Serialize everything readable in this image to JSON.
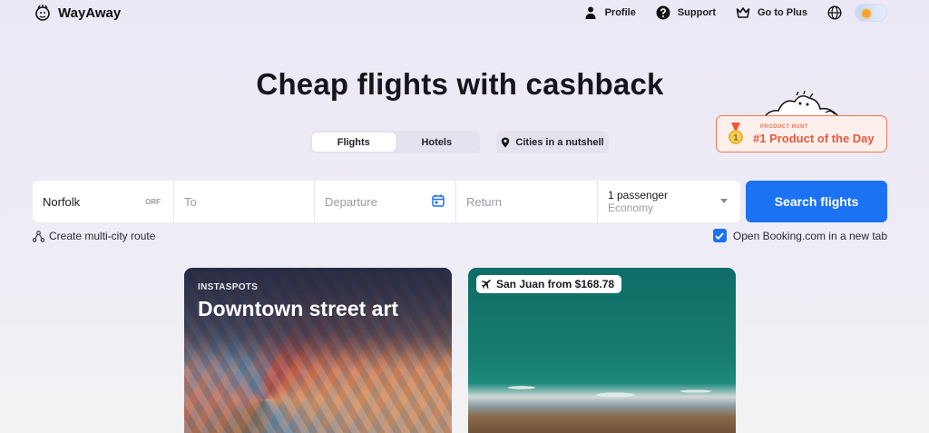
{
  "header": {
    "brand": "WayAway",
    "nav": [
      {
        "label": "Profile",
        "icon": "person-icon"
      },
      {
        "label": "Support",
        "icon": "help-icon"
      },
      {
        "label": "Go to Plus",
        "icon": "crown-icon"
      }
    ],
    "language_icon": "globe-icon",
    "currency_icon": "flag-icon"
  },
  "hero": {
    "title": "Cheap flights with cashback"
  },
  "tabs": [
    {
      "label": "Flights",
      "active": true
    },
    {
      "label": "Hotels",
      "active": false
    }
  ],
  "cities_button": "Cities in a nutshell",
  "product_hunt": {
    "small": "PRODUCT HUNT",
    "big": "#1 Product of the Day",
    "medal_number": "1"
  },
  "search": {
    "origin_value": "Norfolk",
    "origin_code": "ORF",
    "to_placeholder": "To",
    "departure_placeholder": "Departure",
    "return_placeholder": "Return",
    "passengers": "1 passenger",
    "cabin": "Economy",
    "button": "Search flights"
  },
  "multi_city": "Create multi-city route",
  "booking_checkbox": {
    "label": "Open Booking.com in a new tab",
    "checked": true
  },
  "cards": [
    {
      "eyebrow": "INSTASPOTS",
      "title": "Downtown street art"
    },
    {
      "price_tag": "San Juan from $168.78"
    }
  ],
  "colors": {
    "accent": "#1b72f2",
    "product_hunt": "#f0553a",
    "background": "#ece9f6"
  }
}
